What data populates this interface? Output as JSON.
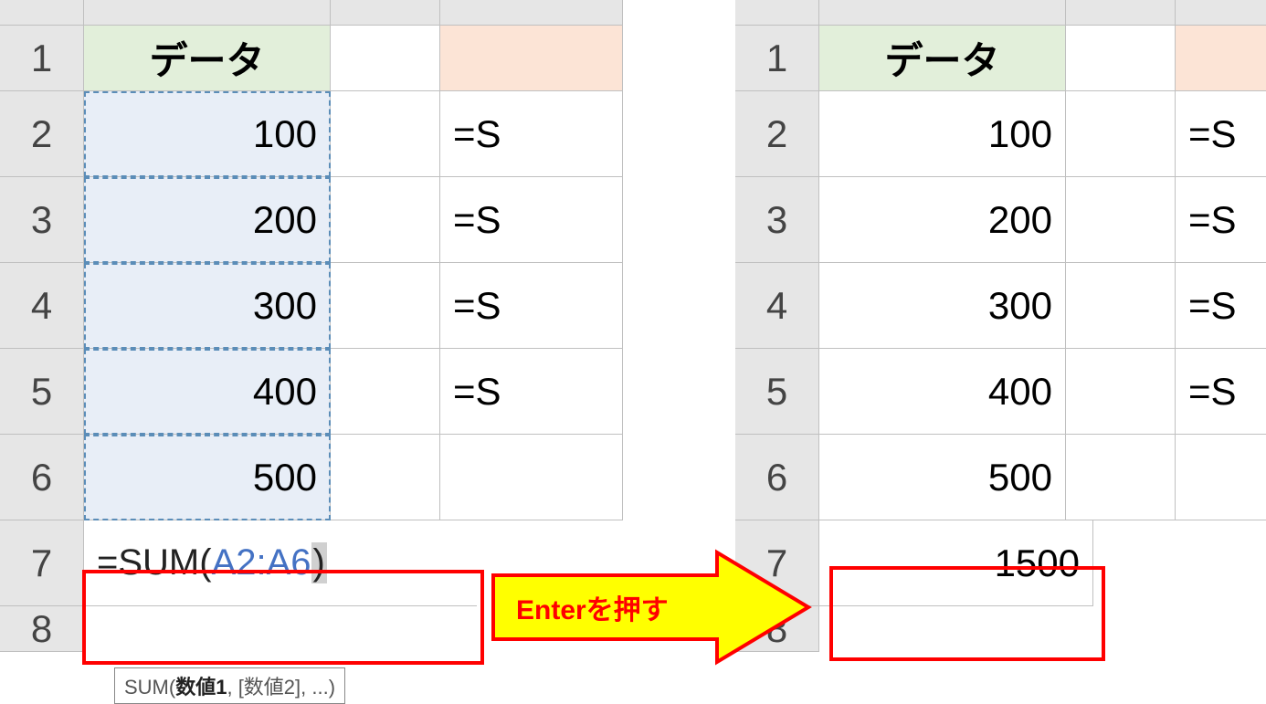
{
  "left": {
    "rows": [
      "1",
      "2",
      "3",
      "4",
      "5",
      "6",
      "7",
      "8"
    ],
    "header": "データ",
    "data": [
      "100",
      "200",
      "300",
      "400",
      "500"
    ],
    "formula_prefix": "=SUM(",
    "formula_range": "A2:A6",
    "formula_suffix": ")",
    "c_col": [
      "",
      "=S",
      "=S",
      "=S",
      "=S",
      "",
      ""
    ],
    "tooltip_fn": "SUM(",
    "tooltip_bold": "数値1",
    "tooltip_rest": ", [数値2], ...)"
  },
  "right": {
    "rows": [
      "1",
      "2",
      "3",
      "4",
      "5",
      "6",
      "7",
      "8"
    ],
    "header": "データ",
    "data": [
      "100",
      "200",
      "300",
      "400",
      "500"
    ],
    "result": "1500",
    "c_col": [
      "",
      "=S",
      "=S",
      "=S",
      "=S",
      "",
      ""
    ]
  },
  "arrow_text": "Enterを押す"
}
